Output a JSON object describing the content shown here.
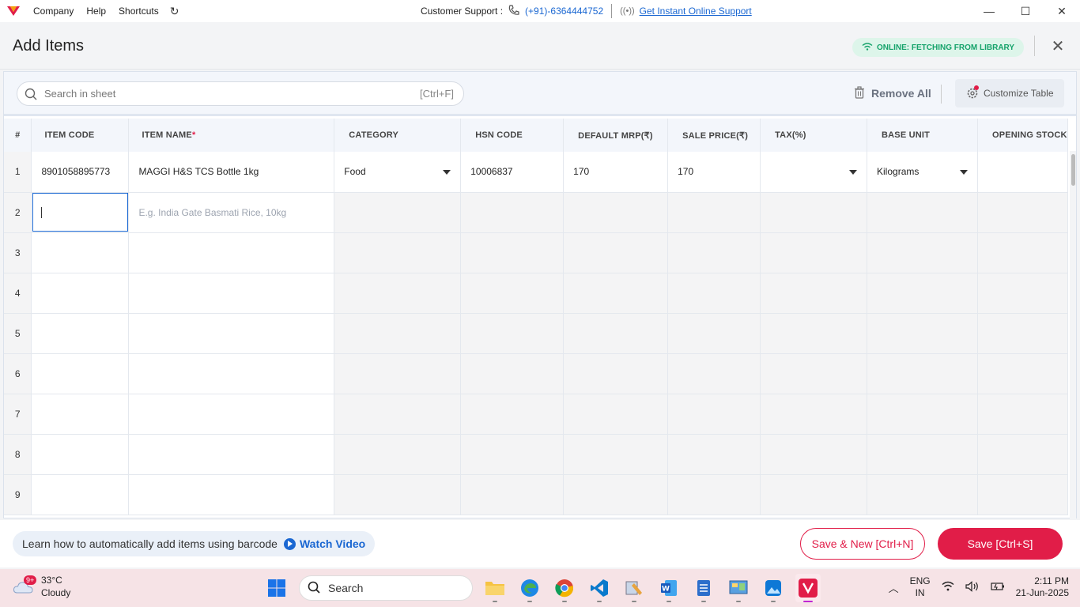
{
  "titlebar": {
    "menu": [
      "Company",
      "Help",
      "Shortcuts"
    ],
    "support_label": "Customer Support :",
    "support_phone": "(+91)-6364444752",
    "support_link": "Get Instant Online Support"
  },
  "header": {
    "title": "Add Items",
    "status_badge": "ONLINE: FETCHING FROM LIBRARY"
  },
  "toolbar": {
    "search_placeholder": "Search in sheet",
    "search_shortcut": "[Ctrl+F]",
    "remove_all": "Remove All",
    "customize": "Customize Table"
  },
  "table": {
    "columns": [
      {
        "label": "#",
        "required": false
      },
      {
        "label": "ITEM CODE",
        "required": false
      },
      {
        "label": "ITEM NAME",
        "required": true
      },
      {
        "label": "CATEGORY",
        "required": false
      },
      {
        "label": "HSN CODE",
        "required": false
      },
      {
        "label": "DEFAULT MRP(₹)",
        "required": false
      },
      {
        "label": "SALE PRICE(₹)",
        "required": false
      },
      {
        "label": "TAX(%)",
        "required": false
      },
      {
        "label": "BASE UNIT",
        "required": false
      },
      {
        "label": "OPENING STOCK",
        "required": false
      }
    ],
    "rows": [
      {
        "index": "1",
        "item_code": "8901058895773",
        "item_name": "MAGGI H&S TCS Bottle 1kg",
        "category": "Food",
        "hsn": "10006837",
        "mrp": "170",
        "sale_price": "170",
        "tax": "",
        "base_unit": "Kilograms",
        "opening_stock": ""
      },
      {
        "index": "2",
        "item_code": "",
        "item_name": "",
        "category": "",
        "hsn": "",
        "mrp": "",
        "sale_price": "",
        "tax": "",
        "base_unit": "",
        "opening_stock": ""
      },
      {
        "index": "3"
      },
      {
        "index": "4"
      },
      {
        "index": "5"
      },
      {
        "index": "6"
      },
      {
        "index": "7"
      },
      {
        "index": "8"
      },
      {
        "index": "9"
      }
    ],
    "item_name_placeholder": "E.g. India Gate Basmati Rice, 10kg"
  },
  "footer": {
    "learn_text": "Learn how to automatically add items using barcode",
    "watch_video": "Watch Video",
    "save_new": "Save & New [Ctrl+N]",
    "save": "Save [Ctrl+S]"
  },
  "taskbar": {
    "temperature": "33°C",
    "weather": "Cloudy",
    "notif_badge": "9+",
    "search_label": "Search",
    "lang_top": "ENG",
    "lang_bottom": "IN",
    "time": "2:11 PM",
    "date": "21-Jun-2025"
  },
  "colors": {
    "brand_red": "#e11d48",
    "link_blue": "#1a67d2",
    "online_green": "#16a36b"
  }
}
